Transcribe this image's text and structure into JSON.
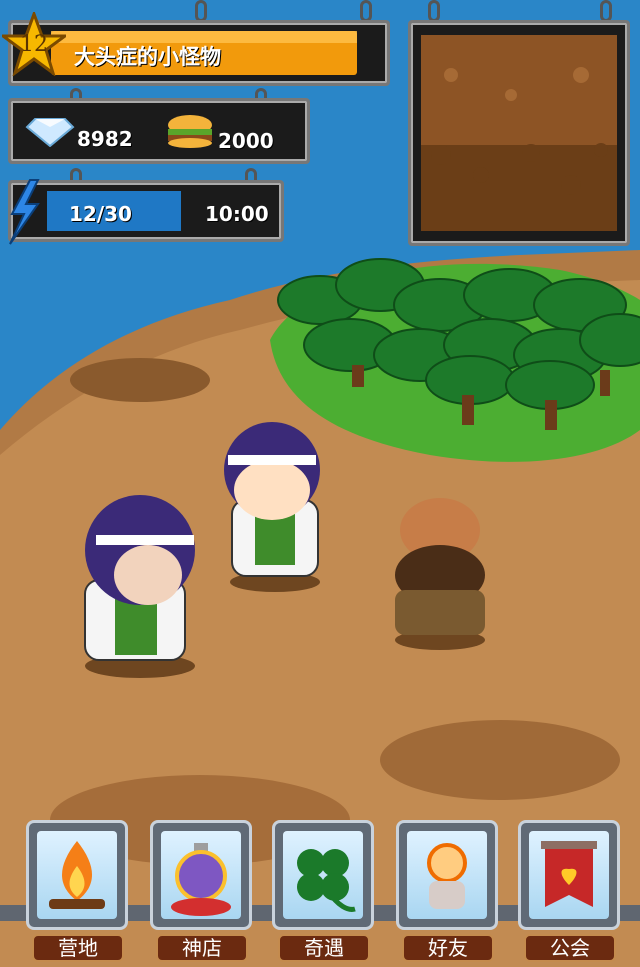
{
  "player": {
    "level": "12",
    "name": "大头症的小怪物"
  },
  "resources": {
    "diamonds": "8982",
    "burgers": "2000"
  },
  "energy": {
    "value": "12/30",
    "current": 12,
    "max": 30,
    "timer": "10:00"
  },
  "nav": [
    {
      "label": "营地",
      "icon": "campfire-icon"
    },
    {
      "label": "神店",
      "icon": "potion-icon"
    },
    {
      "label": "奇遇",
      "icon": "clover-icon"
    },
    {
      "label": "好友",
      "icon": "friend-icon"
    },
    {
      "label": "公会",
      "icon": "guild-banner-icon"
    }
  ],
  "colors": {
    "sea": "#2a86c8",
    "sand": "#b17a45",
    "grass": "#4cae32",
    "name_bar": "#f29a0c",
    "energy_bar": "#1f78c5"
  }
}
